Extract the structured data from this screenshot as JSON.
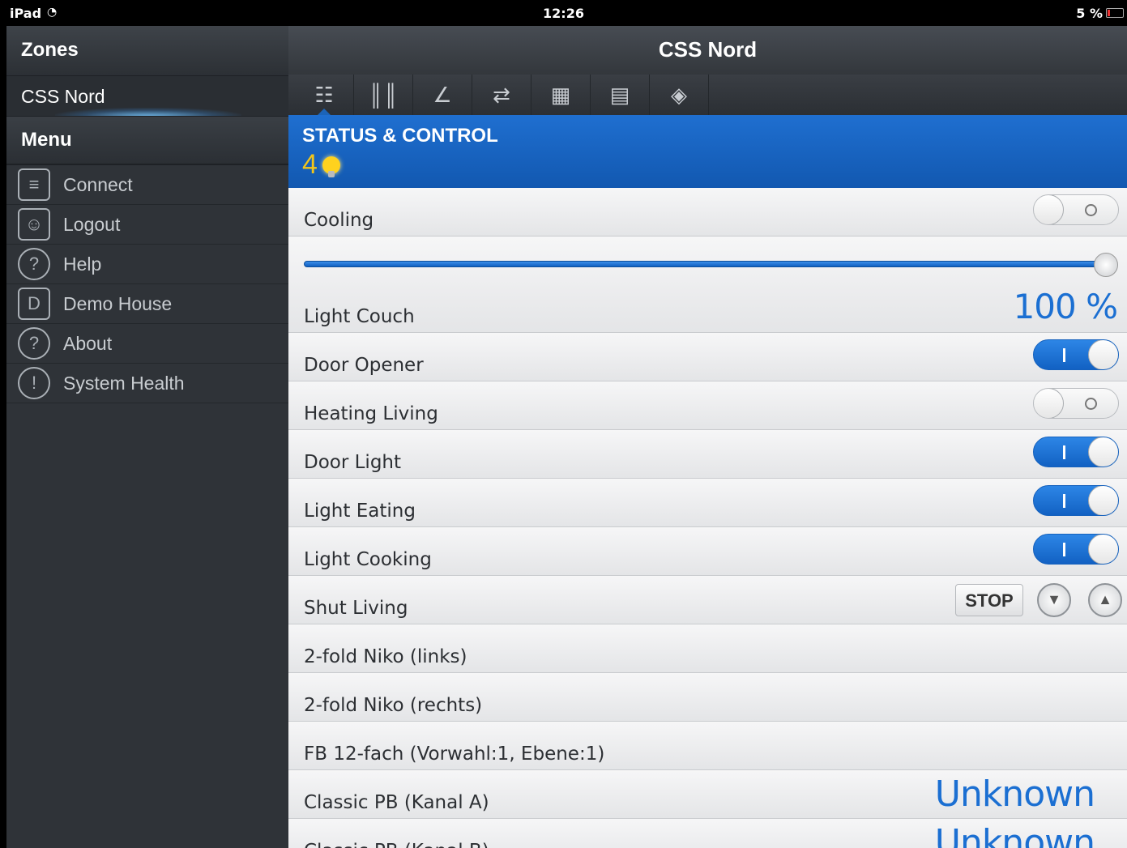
{
  "statusbar": {
    "device": "iPad",
    "time": "12:26",
    "battery": "5 %"
  },
  "sidebar": {
    "zones_title": "Zones",
    "zone_selected": "CSS Nord",
    "menu_title": "Menu",
    "items": [
      {
        "label": "Connect",
        "icon": "connect-icon"
      },
      {
        "label": "Logout",
        "icon": "logout-icon"
      },
      {
        "label": "Help",
        "icon": "help-icon"
      },
      {
        "label": "Demo House",
        "icon": "demo-house-icon"
      },
      {
        "label": "About",
        "icon": "about-icon"
      },
      {
        "label": "System Health",
        "icon": "system-health-icon"
      }
    ]
  },
  "main": {
    "title": "CSS Nord",
    "tabs": [
      "status-control-icon",
      "heating-icon",
      "chart-icon",
      "scenes-icon",
      "grid-icon",
      "calendar-icon",
      "camera-icon"
    ],
    "section": {
      "title": "STATUS & CONTROL",
      "count": "4"
    },
    "rows": {
      "cooling": "Cooling",
      "light_couch": "Light Couch",
      "light_couch_value": "100 %",
      "door_opener": "Door Opener",
      "heating_living": "Heating Living",
      "door_light": "Door Light",
      "light_eating": "Light Eating",
      "light_cooking": "Light Cooking",
      "shut_living": "Shut Living",
      "stop_label": "STOP",
      "niko_links": "2-fold Niko  (links)",
      "niko_rechts": "2-fold Niko  (rechts)",
      "fb12": "FB 12-fach  (Vorwahl:1, Ebene:1)",
      "classic_a": "Classic PB  (Kanal A)",
      "classic_a_value": "Unknown",
      "classic_b": "Classic PB  (Kanal B)",
      "classic_b_value": "Unknown"
    },
    "slider_level_percent": 100
  },
  "colors": {
    "accent": "#1b6fd2",
    "sidebar": "#2f3338",
    "bulb": "#ffd21e"
  }
}
